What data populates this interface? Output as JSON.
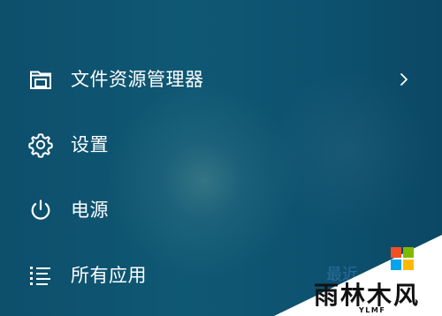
{
  "menu": {
    "items": [
      {
        "label": "文件资源管理器",
        "icon": "file-explorer-icon",
        "has_submenu": true
      },
      {
        "label": "设置",
        "icon": "gear-icon",
        "has_submenu": false
      },
      {
        "label": "电源",
        "icon": "power-icon",
        "has_submenu": false
      },
      {
        "label": "所有应用",
        "icon": "all-apps-icon",
        "has_submenu": false
      }
    ]
  },
  "partial_text": "最近",
  "watermark": {
    "brand_text": "雨林木风",
    "sub_text": "YLMF",
    "colors": {
      "red": "#f25022",
      "green": "#7fba00",
      "blue": "#00a4ef",
      "yellow": "#ffb900"
    }
  },
  "colors": {
    "background": "#0f5874",
    "foreground": "#ffffff",
    "watermark_bg": "#ffffff",
    "watermark_text": "#111111"
  }
}
